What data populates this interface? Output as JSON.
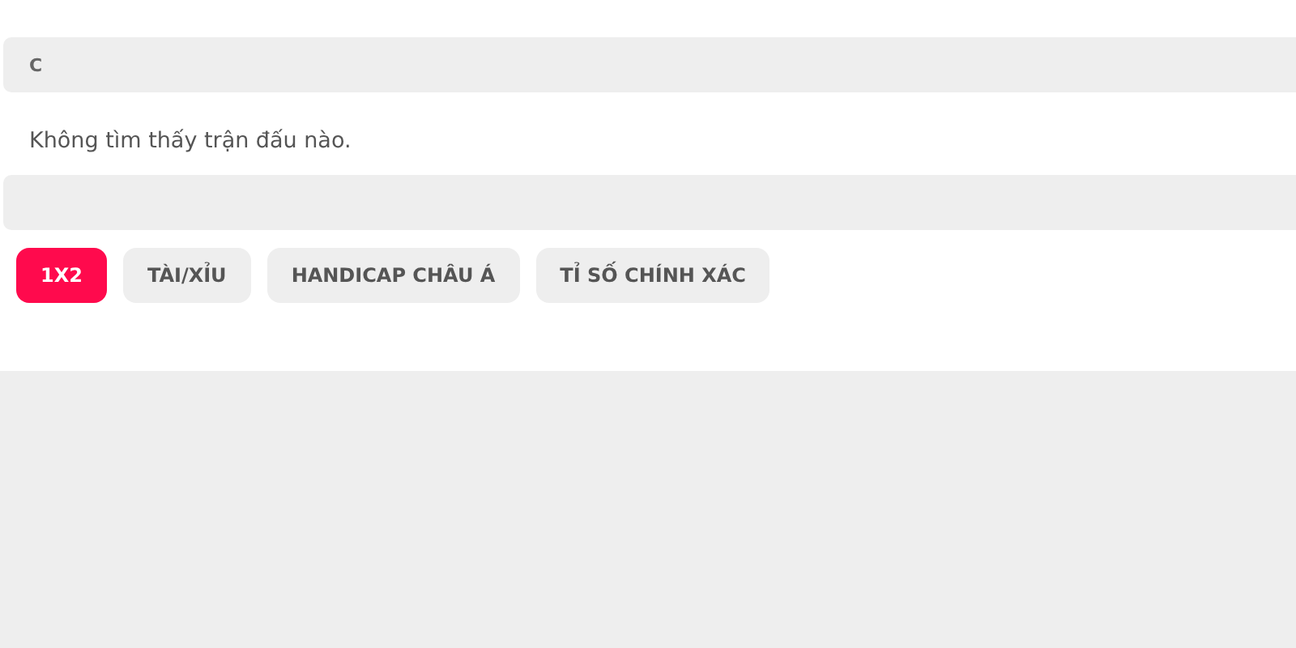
{
  "header": {
    "title": "C"
  },
  "message": "Không tìm thấy trận đấu nào.",
  "tabs": [
    {
      "label": "1X2",
      "selected": true
    },
    {
      "label": "TÀI/XỈU",
      "selected": false
    },
    {
      "label": "HANDICAP CHÂU Á",
      "selected": false
    },
    {
      "label": "TỈ SỐ CHÍNH XÁC",
      "selected": false
    }
  ]
}
